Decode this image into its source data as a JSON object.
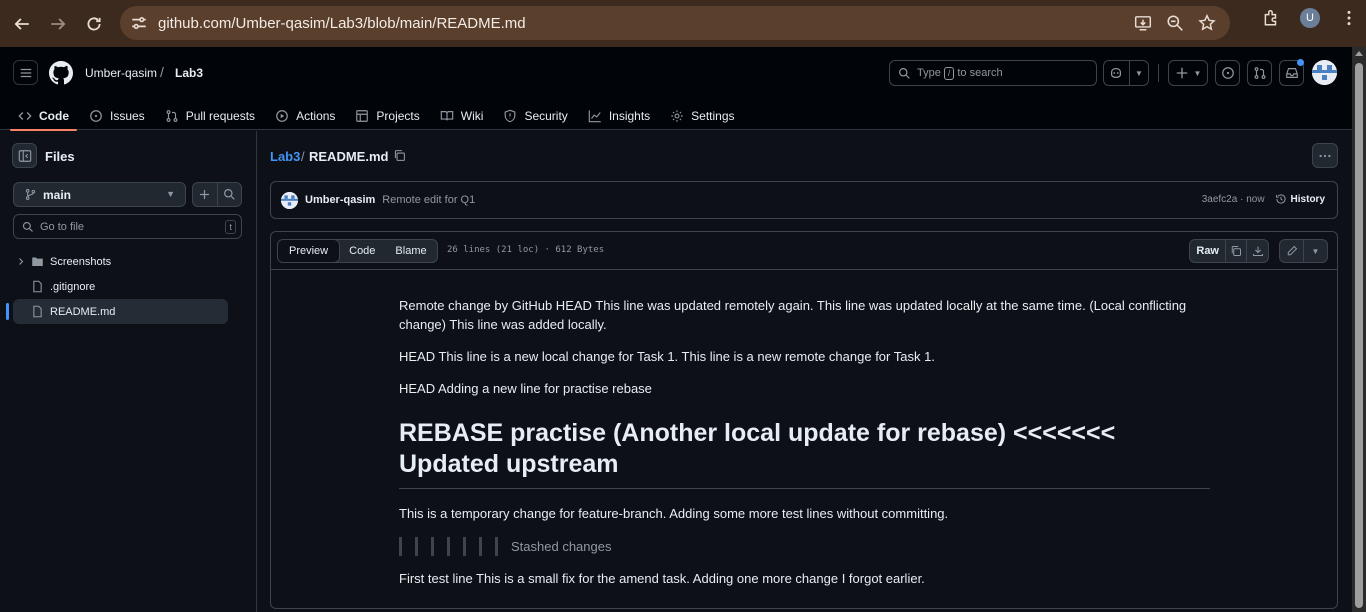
{
  "browser": {
    "url": "github.com/Umber-qasim/Lab3/blob/main/README.md",
    "profile_initial": "U"
  },
  "header": {
    "owner": "Umber-qasim",
    "separator": "/",
    "repo": "Lab3",
    "search_prefix": "Type",
    "search_key": "/",
    "search_suffix": "to search"
  },
  "repo_nav": [
    {
      "label": "Code",
      "icon": "code-icon",
      "active": true
    },
    {
      "label": "Issues",
      "icon": "issue-icon"
    },
    {
      "label": "Pull requests",
      "icon": "pull-request-icon"
    },
    {
      "label": "Actions",
      "icon": "play-icon"
    },
    {
      "label": "Projects",
      "icon": "table-icon"
    },
    {
      "label": "Wiki",
      "icon": "book-icon"
    },
    {
      "label": "Security",
      "icon": "shield-icon"
    },
    {
      "label": "Insights",
      "icon": "graph-icon"
    },
    {
      "label": "Settings",
      "icon": "gear-icon"
    }
  ],
  "sidebar": {
    "title": "Files",
    "branch": "main",
    "goto_placeholder": "Go to file",
    "goto_key": "t",
    "tree": [
      {
        "label": "Screenshots",
        "type": "folder"
      },
      {
        "label": ".gitignore",
        "type": "file"
      },
      {
        "label": "README.md",
        "type": "file",
        "active": true
      }
    ]
  },
  "breadcrumb": {
    "repo": "Lab3",
    "separator": "/",
    "file": "README.md"
  },
  "commit": {
    "author": "Umber-qasim",
    "message": "Remote edit for Q1",
    "sha_time": "3aefc2a · now",
    "history_label": "History"
  },
  "file": {
    "tabs": [
      "Preview",
      "Code",
      "Blame"
    ],
    "meta": "26 lines (21 loc) · 612 Bytes",
    "raw_label": "Raw"
  },
  "readme": {
    "p1": "Remote change by GitHub HEAD This line was updated remotely again. This line was updated locally at the same time. (Local conflicting change) This line was added locally.",
    "p2": "HEAD This line is a new local change for Task 1. This line is a new remote change for Task 1.",
    "p3": "HEAD Adding a new line for practise rebase",
    "h1": "REBASE practise (Another local update for rebase) <<<<<<< Updated upstream",
    "p4": "This is a temporary change for feature-branch. Adding some more test lines without committing.",
    "quote": "Stashed changes",
    "p5": "First test line This is a small fix for the amend task. Adding one more change I forgot earlier."
  },
  "colors": {
    "accent_link": "#4493f8",
    "tab_underline": "#f78166",
    "chrome_bg": "#3c2a1e"
  }
}
